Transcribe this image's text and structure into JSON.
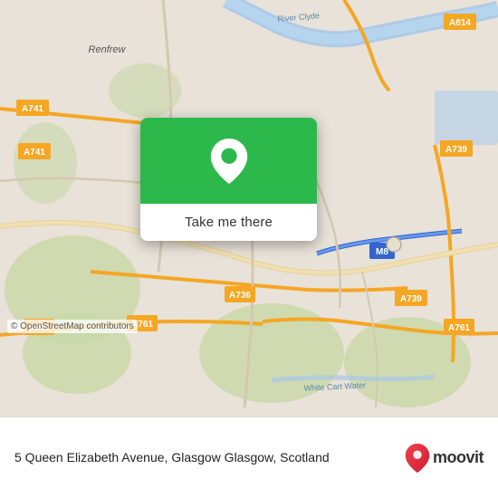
{
  "map": {
    "background_color": "#ede8e0",
    "center_lat": 55.855,
    "center_lon": -4.38
  },
  "popup": {
    "button_label": "Take me there",
    "header_color": "#2db84b"
  },
  "bottom_bar": {
    "address": "5 Queen Elizabeth Avenue, Glasgow Glasgow,\nScotland",
    "copyright": "© OpenStreetMap contributors",
    "logo_text": "moovit"
  },
  "roads": {
    "a741_label": "A741",
    "a739_label": "A739",
    "a736_label": "A736",
    "a761_label": "A761",
    "a814_label": "A814",
    "m8_label": "M8",
    "renfrew_label": "Renfrew",
    "river_clyde_label": "River Clyde",
    "white_cart_label": "White Cart Water"
  }
}
